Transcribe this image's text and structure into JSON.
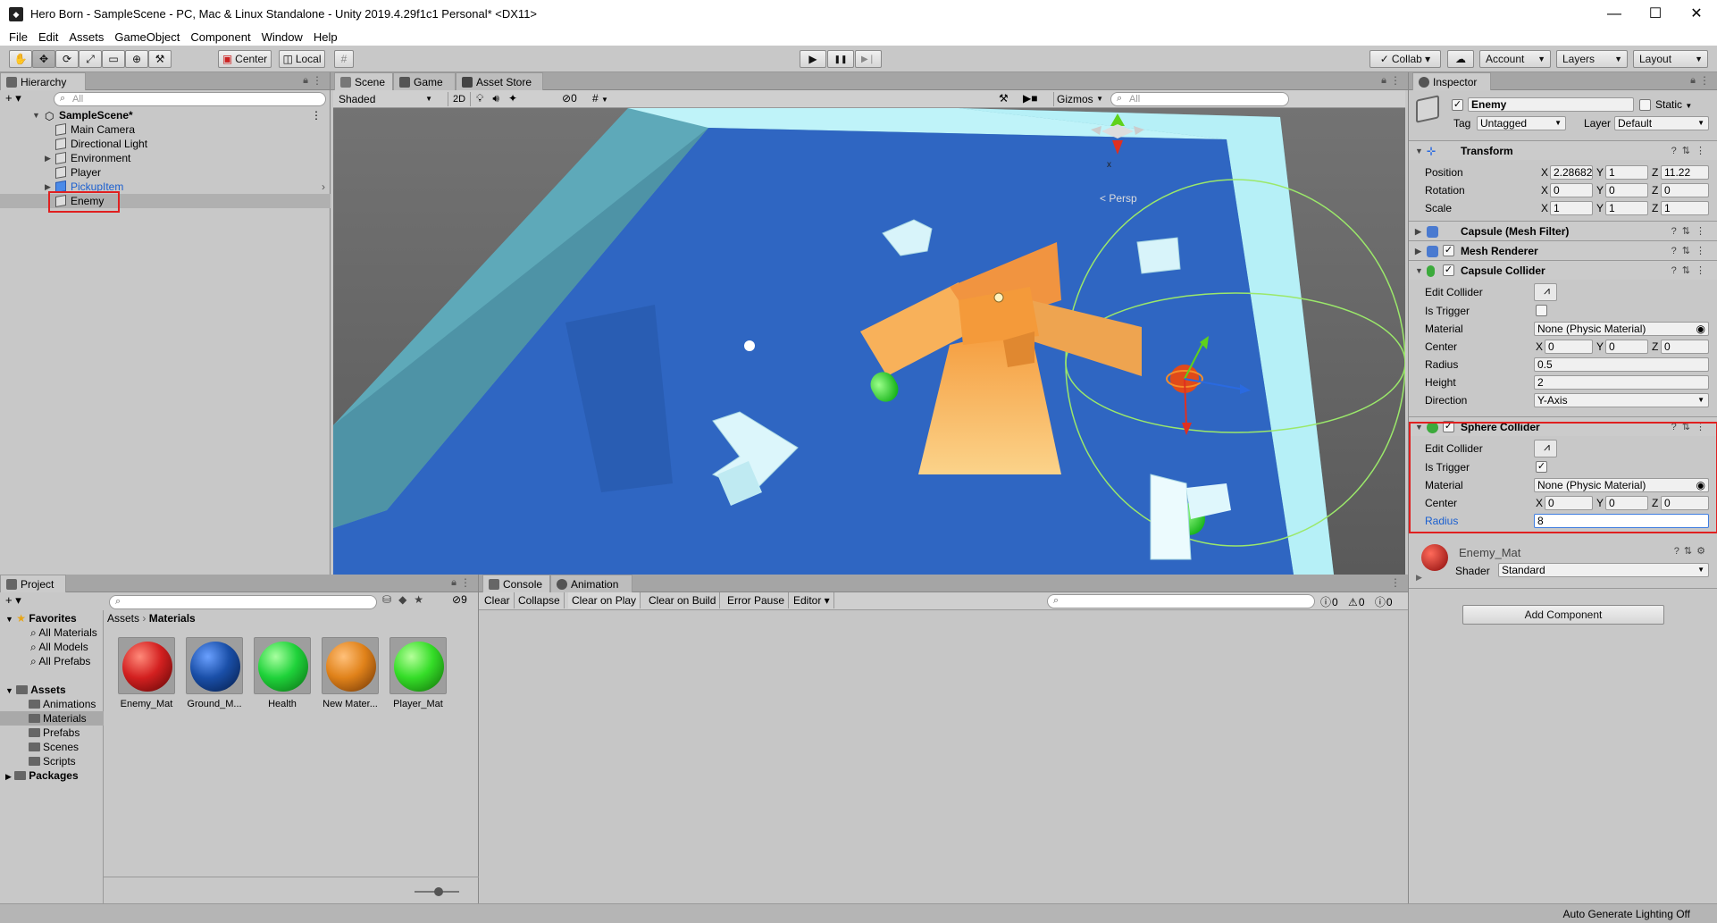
{
  "window": {
    "title": "Hero Born - SampleScene - PC, Mac & Linux Standalone - Unity 2019.4.29f1c1 Personal* <DX11>",
    "minimize": "—",
    "maximize": "☐",
    "close": "✕"
  },
  "menu": [
    "File",
    "Edit",
    "Assets",
    "GameObject",
    "Component",
    "Window",
    "Help"
  ],
  "toolbar": {
    "pivot": "Center",
    "space": "Local",
    "collab": "Collab ▾",
    "account": "Account",
    "layers": "Layers",
    "layout": "Layout",
    "play": "▶",
    "pause": "❚❚",
    "step": "▶❘"
  },
  "hierarchy": {
    "tab": "Hierarchy",
    "add": "+ ▾",
    "search_placeholder": "All",
    "scene": "SampleScene*",
    "items": [
      {
        "label": "Main Camera"
      },
      {
        "label": "Directional Light"
      },
      {
        "label": "Environment"
      },
      {
        "label": "Player"
      },
      {
        "label": "PickupItem"
      },
      {
        "label": "Enemy"
      }
    ]
  },
  "scene": {
    "tabs": [
      "Scene",
      "Game",
      "Asset Store"
    ],
    "shading": "Shaded",
    "mode2d": "2D",
    "fx_count": "0",
    "gizmos": "Gizmos",
    "search_placeholder": "All",
    "persp": "< Persp",
    "axes": {
      "y": "y",
      "x": "x",
      "z": "z"
    }
  },
  "inspector": {
    "tab": "Inspector",
    "object_name": "Enemy",
    "static": "Static",
    "tag_label": "Tag",
    "tag_value": "Untagged",
    "layer_label": "Layer",
    "layer_value": "Default",
    "transform": {
      "title": "Transform",
      "position": {
        "label": "Position",
        "x": "2.28682",
        "y": "1",
        "z": "11.22"
      },
      "rotation": {
        "label": "Rotation",
        "x": "0",
        "y": "0",
        "z": "0"
      },
      "scale": {
        "label": "Scale",
        "x": "1",
        "y": "1",
        "z": "1"
      }
    },
    "mesh_filter": "Capsule (Mesh Filter)",
    "mesh_renderer": "Mesh Renderer",
    "capsule": {
      "title": "Capsule Collider",
      "edit_collider": "Edit Collider",
      "is_trigger": "Is Trigger",
      "material_label": "Material",
      "material_value": "None (Physic Material)",
      "center_label": "Center",
      "center": {
        "x": "0",
        "y": "0",
        "z": "0"
      },
      "radius_label": "Radius",
      "radius_value": "0.5",
      "height_label": "Height",
      "height_value": "2",
      "direction_label": "Direction",
      "direction_value": "Y-Axis"
    },
    "sphere": {
      "title": "Sphere Collider",
      "edit_collider": "Edit Collider",
      "is_trigger": "Is Trigger",
      "material_label": "Material",
      "material_value": "None (Physic Material)",
      "center_label": "Center",
      "center": {
        "x": "0",
        "y": "0",
        "z": "0"
      },
      "radius_label": "Radius",
      "radius_value": "8"
    },
    "material": {
      "name": "Enemy_Mat",
      "shader_label": "Shader",
      "shader_value": "Standard"
    },
    "add_component": "Add Component",
    "axis_x": "X",
    "axis_y": "Y",
    "axis_z": "Z"
  },
  "project": {
    "tab": "Project",
    "hidden_count": "9",
    "favorites": "Favorites",
    "favorites_items": [
      "All Materials",
      "All Models",
      "All Prefabs"
    ],
    "assets": "Assets",
    "assets_items": [
      "Animations",
      "Materials",
      "Prefabs",
      "Scenes",
      "Scripts"
    ],
    "packages": "Packages",
    "breadcrumb": [
      "Assets",
      "Materials"
    ],
    "materials": [
      {
        "label": "Enemy_Mat",
        "color": "#d32020"
      },
      {
        "label": "Ground_M...",
        "color": "#1a4fa8"
      },
      {
        "label": "Health",
        "color": "#1fd23a"
      },
      {
        "label": "New Mater...",
        "color": "#e0821a"
      },
      {
        "label": "Player_Mat",
        "color": "#35dd28"
      }
    ]
  },
  "console": {
    "tabs": [
      "Console",
      "Animation"
    ],
    "buttons": [
      "Clear",
      "Collapse",
      "Clear on Play",
      "Clear on Build",
      "Error Pause",
      "Editor ▾"
    ],
    "counts": {
      "log": "0",
      "warn": "0",
      "error": "0"
    }
  },
  "status": {
    "lighting": "Auto Generate Lighting Off"
  },
  "colors": {
    "highlight_red": "#e02020",
    "selection_blue": "#3e7de0",
    "floor_blue": "#2f66c2",
    "wall_cyan": "#a8e9f3",
    "ramp_orange": "#f5a34a"
  }
}
